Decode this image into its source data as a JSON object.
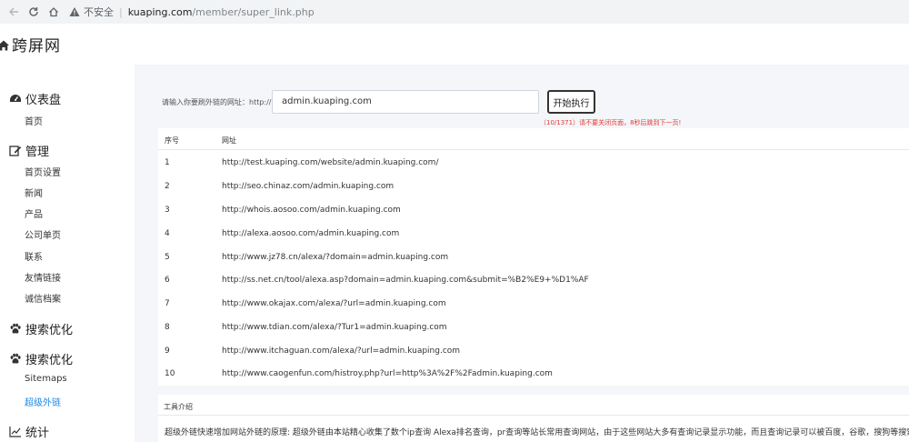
{
  "browser": {
    "insecure_label": "不安全",
    "url_host": "kuaping.com",
    "url_path": "/member/super_link.php"
  },
  "site": {
    "name": "跨屏网"
  },
  "sidebar": {
    "groups": [
      {
        "title": "仪表盘",
        "icon": "dashboard-icon",
        "items": [
          "首页"
        ]
      },
      {
        "title": "管理",
        "icon": "edit-icon",
        "items": [
          "首页设置",
          "新闻",
          "产品",
          "公司单页",
          "联系",
          "友情链接",
          "诚信档案"
        ]
      },
      {
        "title": "搜索优化",
        "icon": "paw-icon",
        "items": []
      },
      {
        "title": "搜索优化",
        "icon": "paw-icon",
        "items": [
          "Sitemaps",
          "超级外链"
        ]
      },
      {
        "title": "统计",
        "icon": "chart-icon",
        "items": []
      }
    ],
    "active_item": "超级外链"
  },
  "form": {
    "label": "请输入你要刷外链的网址：http://",
    "value": "admin.kuaping.com",
    "button": "开始执行",
    "progress": "（10/1371）请不要关闭页面，8秒后跳到下一页!"
  },
  "table": {
    "headers": [
      "序号",
      "网址"
    ],
    "rows": [
      {
        "no": "1",
        "url": "http://test.kuaping.com/website/admin.kuaping.com/"
      },
      {
        "no": "2",
        "url": "http://seo.chinaz.com/admin.kuaping.com"
      },
      {
        "no": "3",
        "url": "http://whois.aosoo.com/admin.kuaping.com"
      },
      {
        "no": "4",
        "url": "http://alexa.aosoo.com/admin.kuaping.com"
      },
      {
        "no": "5",
        "url": "http://www.jz78.cn/alexa/?domain=admin.kuaping.com"
      },
      {
        "no": "6",
        "url": "http://ss.net.cn/tool/alexa.asp?domain=admin.kuaping.com&submit=%B2%E9+%D1%AF"
      },
      {
        "no": "7",
        "url": "http://www.okajax.com/alexa/?url=admin.kuaping.com"
      },
      {
        "no": "8",
        "url": "http://www.tdian.com/alexa/?Tur1=admin.kuaping.com"
      },
      {
        "no": "9",
        "url": "http://www.itchaguan.com/alexa/?url=admin.kuaping.com"
      },
      {
        "no": "10",
        "url": "http://www.caogenfun.com/histroy.php?url=http%3A%2F%2Fadmin.kuaping.com"
      }
    ]
  },
  "tool": {
    "title": "工具介绍",
    "description": "超级外链快速增加网站外链的原理: 超级外链由本站精心收集了数个ip查询 Alexa排名查询，pr查询等站长常用查询网站，由于这些网站大多有查询记录显示功能，而且查询记录可以被百度，谷歌，搜狗等搜索"
  },
  "colors": {
    "active": "#1e88e5",
    "warning": "#e53935",
    "main_bg": "#f4f6f9"
  }
}
